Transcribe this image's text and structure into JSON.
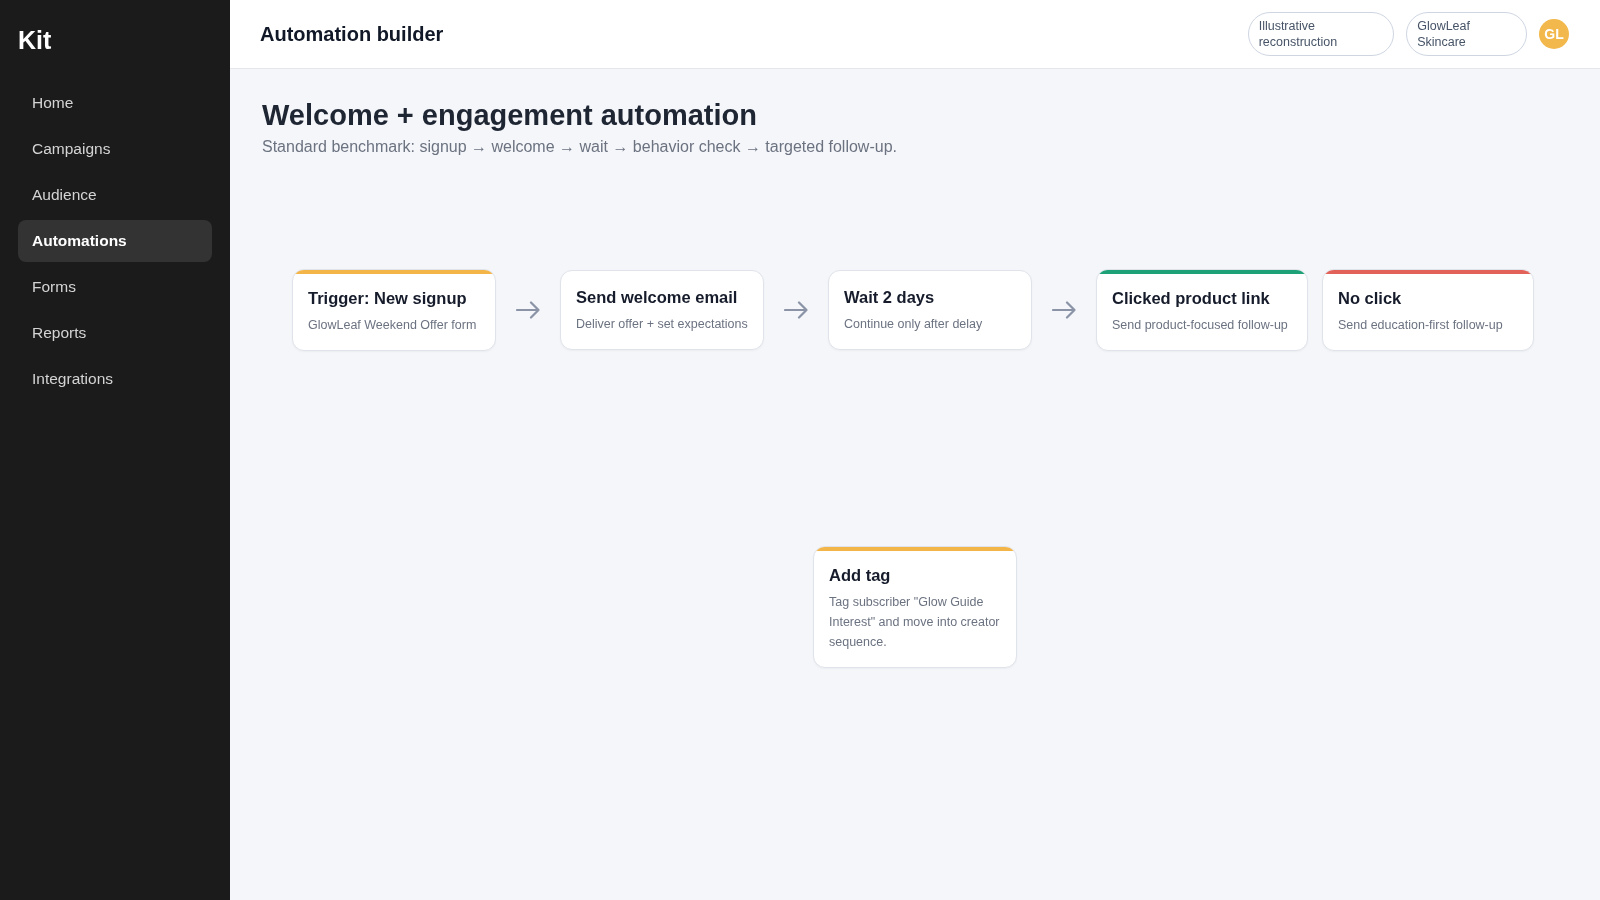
{
  "sidebar": {
    "brand": "Kit",
    "items": [
      {
        "label": "Home",
        "selected": false
      },
      {
        "label": "Campaigns",
        "selected": false
      },
      {
        "label": "Audience",
        "selected": false
      },
      {
        "label": "Automations",
        "selected": true
      },
      {
        "label": "Forms",
        "selected": false
      },
      {
        "label": "Reports",
        "selected": false
      },
      {
        "label": "Integrations",
        "selected": false
      }
    ]
  },
  "header": {
    "title": "Automation builder",
    "chips": [
      "Illustrative reconstruction",
      "GlowLeaf Skincare"
    ],
    "avatar": "GL"
  },
  "page": {
    "title": "Welcome + engagement automation",
    "subtitle": "Standard benchmark: signup → welcome → wait → behavior check → targeted follow-up."
  },
  "flow": {
    "steps": [
      {
        "kind": "step",
        "title": "Trigger: New signup",
        "description": "GlowLeaf Weekend Offer form",
        "color": "#f4b548"
      },
      {
        "kind": "step",
        "title": "Send welcome email",
        "description": "Deliver offer + set expectations"
      },
      {
        "kind": "step",
        "title": "Wait 2 days",
        "description": "Continue only after delay"
      },
      {
        "kind": "split",
        "branches": [
          {
            "title": "Clicked product link",
            "description": "Send product-focused follow-up",
            "color": "#1ea177"
          },
          {
            "title": "No click",
            "description": "Send education-first follow-up",
            "color": "#e2625a"
          }
        ]
      }
    ],
    "detached": [
      {
        "title": "Add tag",
        "description": "Tag subscriber \"Glow Guide Interest\" and move into creator sequence.",
        "color": "#f4b548"
      }
    ]
  }
}
